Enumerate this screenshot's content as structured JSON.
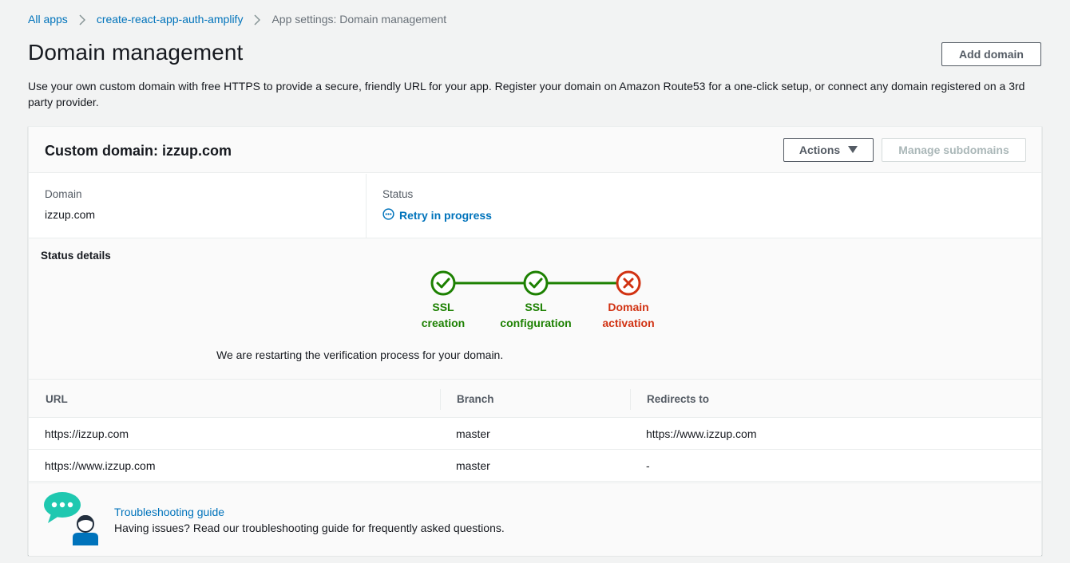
{
  "breadcrumb": {
    "items": [
      {
        "label": "All apps"
      },
      {
        "label": "create-react-app-auth-amplify"
      },
      {
        "label": "App settings: Domain management"
      }
    ]
  },
  "page": {
    "title": "Domain management",
    "add_domain_label": "Add domain",
    "description": "Use your own custom domain with free HTTPS to provide a secure, friendly URL for your app. Register your domain on Amazon Route53 for a one-click setup, or connect any domain registered on a 3rd party provider."
  },
  "domain_panel": {
    "title": "Custom domain: izzup.com",
    "actions_label": "Actions",
    "manage_subdomains_label": "Manage subdomains",
    "domain_label": "Domain",
    "domain_value": "izzup.com",
    "status_label": "Status",
    "status_value": "Retry in progress",
    "status_details_label": "Status details",
    "steps": [
      {
        "line1": "SSL",
        "line2": "creation",
        "state": "complete",
        "color": "#1d8102"
      },
      {
        "line1": "SSL",
        "line2": "configuration",
        "state": "complete",
        "color": "#1d8102"
      },
      {
        "line1": "Domain",
        "line2": "activation",
        "state": "failed",
        "color": "#d13212"
      }
    ],
    "status_message": "We are restarting the verification process for your domain."
  },
  "table": {
    "headers": [
      "URL",
      "Branch",
      "Redirects to"
    ],
    "rows": [
      {
        "url": "https://izzup.com",
        "branch": "master",
        "redirect": "https://www.izzup.com"
      },
      {
        "url": "https://www.izzup.com",
        "branch": "master",
        "redirect": "-"
      }
    ]
  },
  "footer": {
    "link_label": "Troubleshooting guide",
    "text": "Having issues? Read our troubleshooting guide for frequently asked questions."
  },
  "colors": {
    "link": "#0073bb",
    "success": "#1d8102",
    "error": "#d13212",
    "chat_bubble": "#1fc8b0"
  }
}
